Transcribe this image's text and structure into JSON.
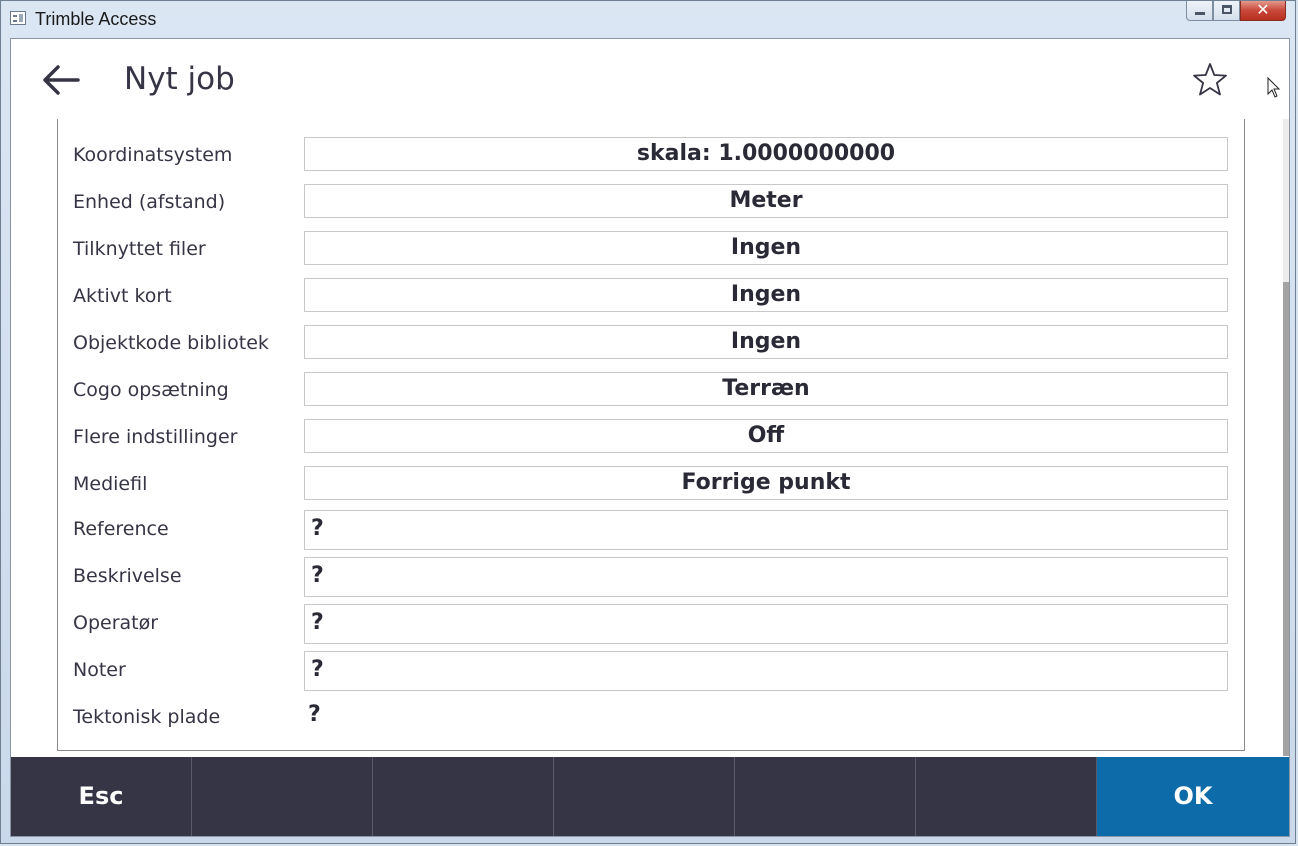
{
  "window": {
    "title": "Trimble Access",
    "close_glyph": "✕"
  },
  "header": {
    "title": "Nyt job"
  },
  "rows": [
    {
      "label": "Koordinatsystem",
      "value": "skala:  1.0000000000",
      "type": "button"
    },
    {
      "label": "Enhed (afstand)",
      "value": "Meter",
      "type": "button"
    },
    {
      "label": "Tilknyttet filer",
      "value": "Ingen",
      "type": "button"
    },
    {
      "label": "Aktivt kort",
      "value": "Ingen",
      "type": "button"
    },
    {
      "label": "Objektkode bibliotek",
      "value": "Ingen",
      "type": "button"
    },
    {
      "label": "Cogo opsætning",
      "value": "Terræn",
      "type": "button"
    },
    {
      "label": "Flere indstillinger",
      "value": "Off",
      "type": "button"
    },
    {
      "label": "Mediefil",
      "value": "Forrige punkt",
      "type": "button"
    },
    {
      "label": "Reference",
      "value": "?",
      "type": "input"
    },
    {
      "label": "Beskrivelse",
      "value": "?",
      "type": "input"
    },
    {
      "label": "Operatør",
      "value": "?",
      "type": "input"
    },
    {
      "label": "Noter",
      "value": "?",
      "type": "input"
    },
    {
      "label": "Tektonisk plade",
      "value": "?",
      "type": "static"
    }
  ],
  "footer": {
    "buttons": [
      "Esc",
      "",
      "",
      "",
      "",
      ""
    ],
    "ok_label": "OK"
  },
  "icons": {
    "back": "arrow-left-icon",
    "favorite": "star-icon"
  },
  "colors": {
    "footer_bg": "#363545",
    "ok_bg": "#0c6ba8",
    "text": "#363545"
  }
}
